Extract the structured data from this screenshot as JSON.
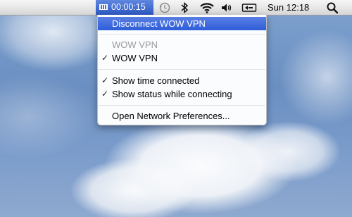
{
  "menubar": {
    "vpn_timer": "00:00:15",
    "clock": "Sun 12:18",
    "icons": [
      "vpn-icon",
      "time-machine-icon",
      "bluetooth-icon",
      "wifi-icon",
      "volume-icon",
      "input-source-icon",
      "spotlight-icon"
    ]
  },
  "menu": {
    "items": {
      "disconnect": "Disconnect WOW VPN",
      "header": "WOW VPN",
      "service": "WOW VPN",
      "show_time": "Show time connected",
      "show_status": "Show status while connecting",
      "open_prefs": "Open Network Preferences..."
    },
    "check_glyph": "✓"
  },
  "colors": {
    "selection": "#2d5dd9",
    "menubar_highlight": "#3a66c9"
  }
}
